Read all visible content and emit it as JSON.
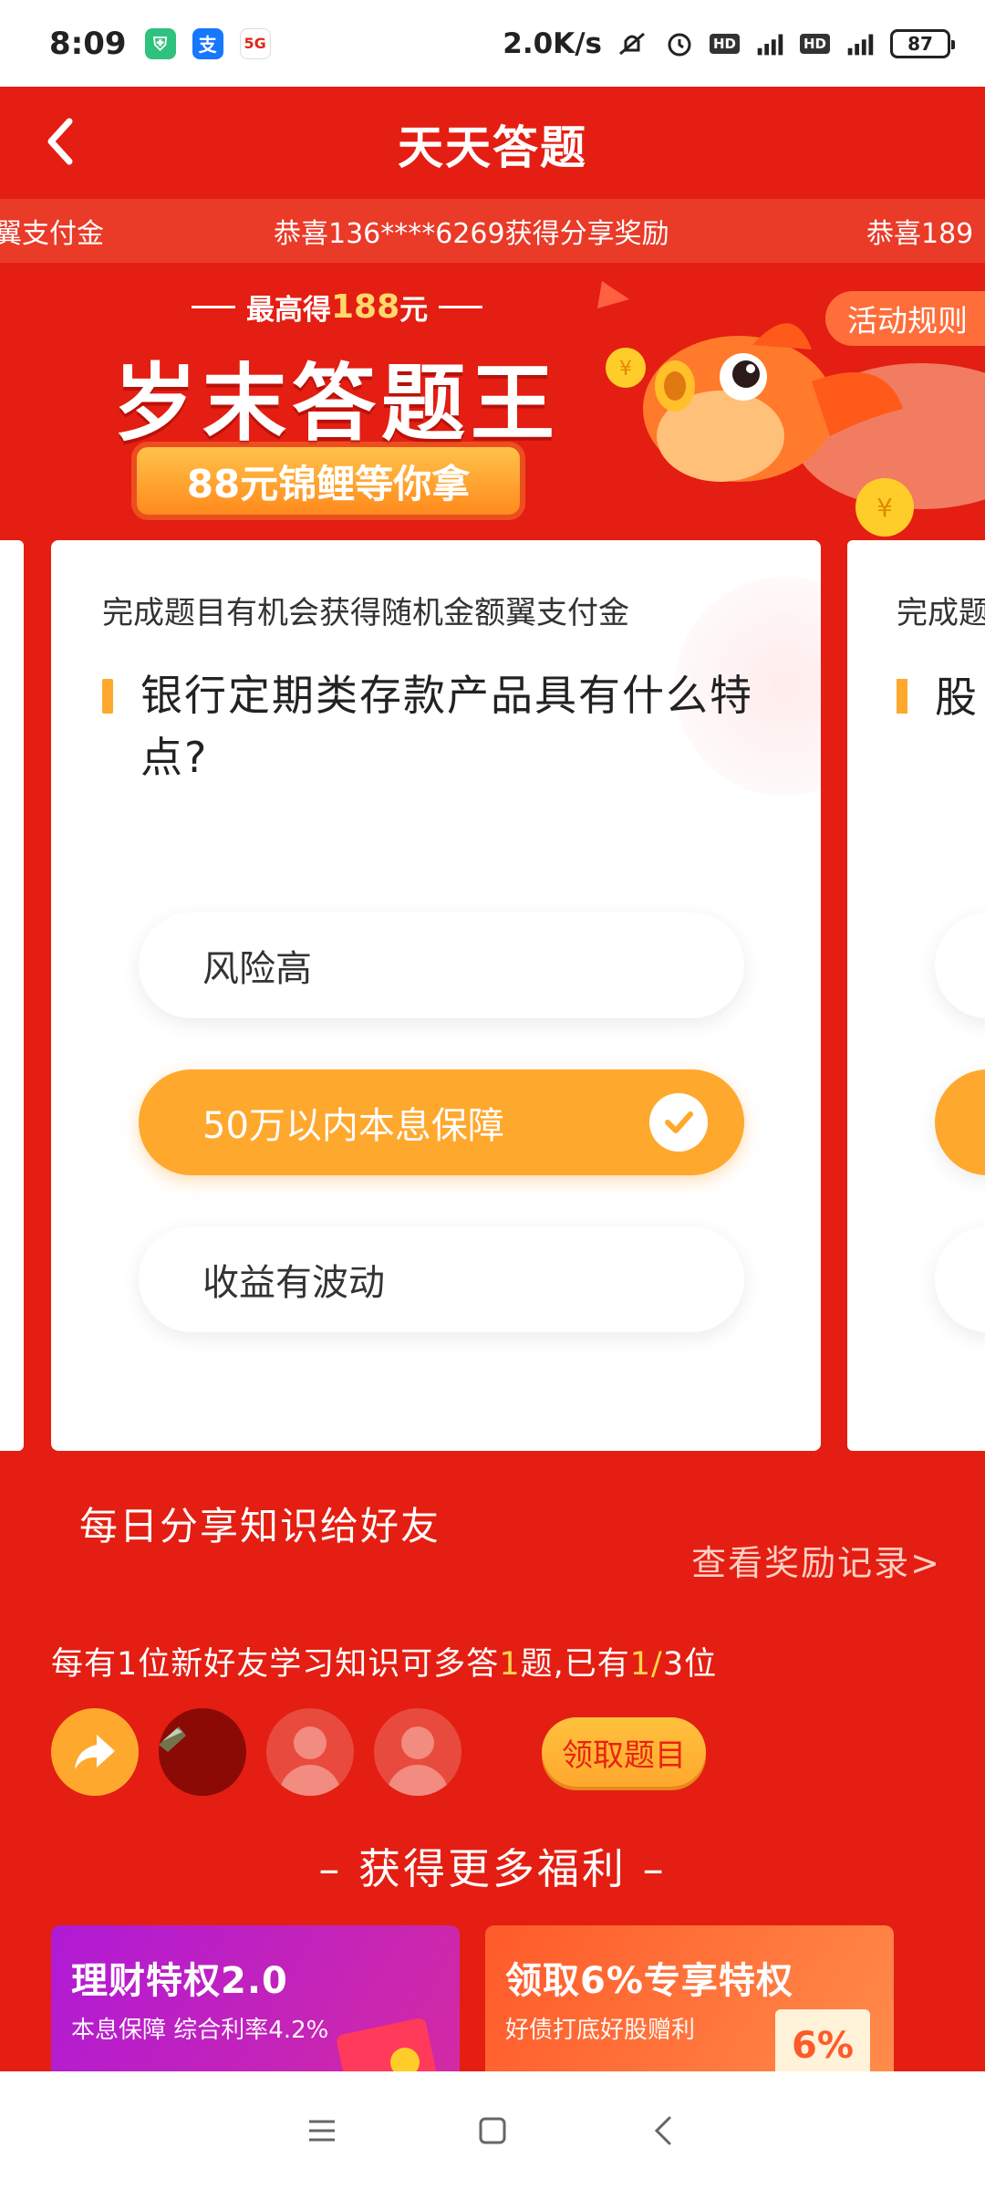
{
  "status_bar": {
    "time": "8:09",
    "net_speed": "2.0K/s",
    "battery": "87",
    "signal1": "4G",
    "signal2": "4G",
    "hd": "HD"
  },
  "header": {
    "title": "天天答题"
  },
  "ticker": {
    "items": [
      "翼支付金",
      "恭喜136****6269获得分享奖励",
      "恭喜189"
    ]
  },
  "banner": {
    "sub_prefix": "最高得",
    "sub_amount": "188",
    "sub_suffix": "元",
    "title": "岁末答题王",
    "pill": "88元锦鲤等你拿",
    "rules": "活动规则"
  },
  "quiz": {
    "hint": "完成题目有机会获得随机金额翼支付金",
    "question": "银行定期类存款产品具有什么特点?",
    "options": [
      {
        "label": "风险高",
        "selected": false
      },
      {
        "label": "50万以内本息保障",
        "selected": true
      },
      {
        "label": "收益有波动",
        "selected": false
      }
    ],
    "peek_hint": "完成题",
    "peek_question": "股"
  },
  "share": {
    "title": "每日分享知识给好友",
    "records_link": "查看奖励记录>",
    "desc_prefix": "每有",
    "desc_n1": "1",
    "desc_mid": "位新好友学习知识可多答",
    "desc_n2": "1",
    "desc_mid2": "题,已有",
    "desc_n3": "1",
    "desc_slash": "/",
    "desc_suffix": "3位",
    "claim": "领取题目"
  },
  "more": {
    "title": "获得更多福利",
    "cards": [
      {
        "title": "理财特权2.0",
        "sub": "本息保障 综合利率4.2%"
      },
      {
        "title": "领取6%专享特权",
        "sub": "好债打底好股赠利",
        "tag": "6%"
      }
    ]
  },
  "colors": {
    "background": "#e41e12",
    "accent": "#ffa82e",
    "highlight": "#ffd54a"
  }
}
